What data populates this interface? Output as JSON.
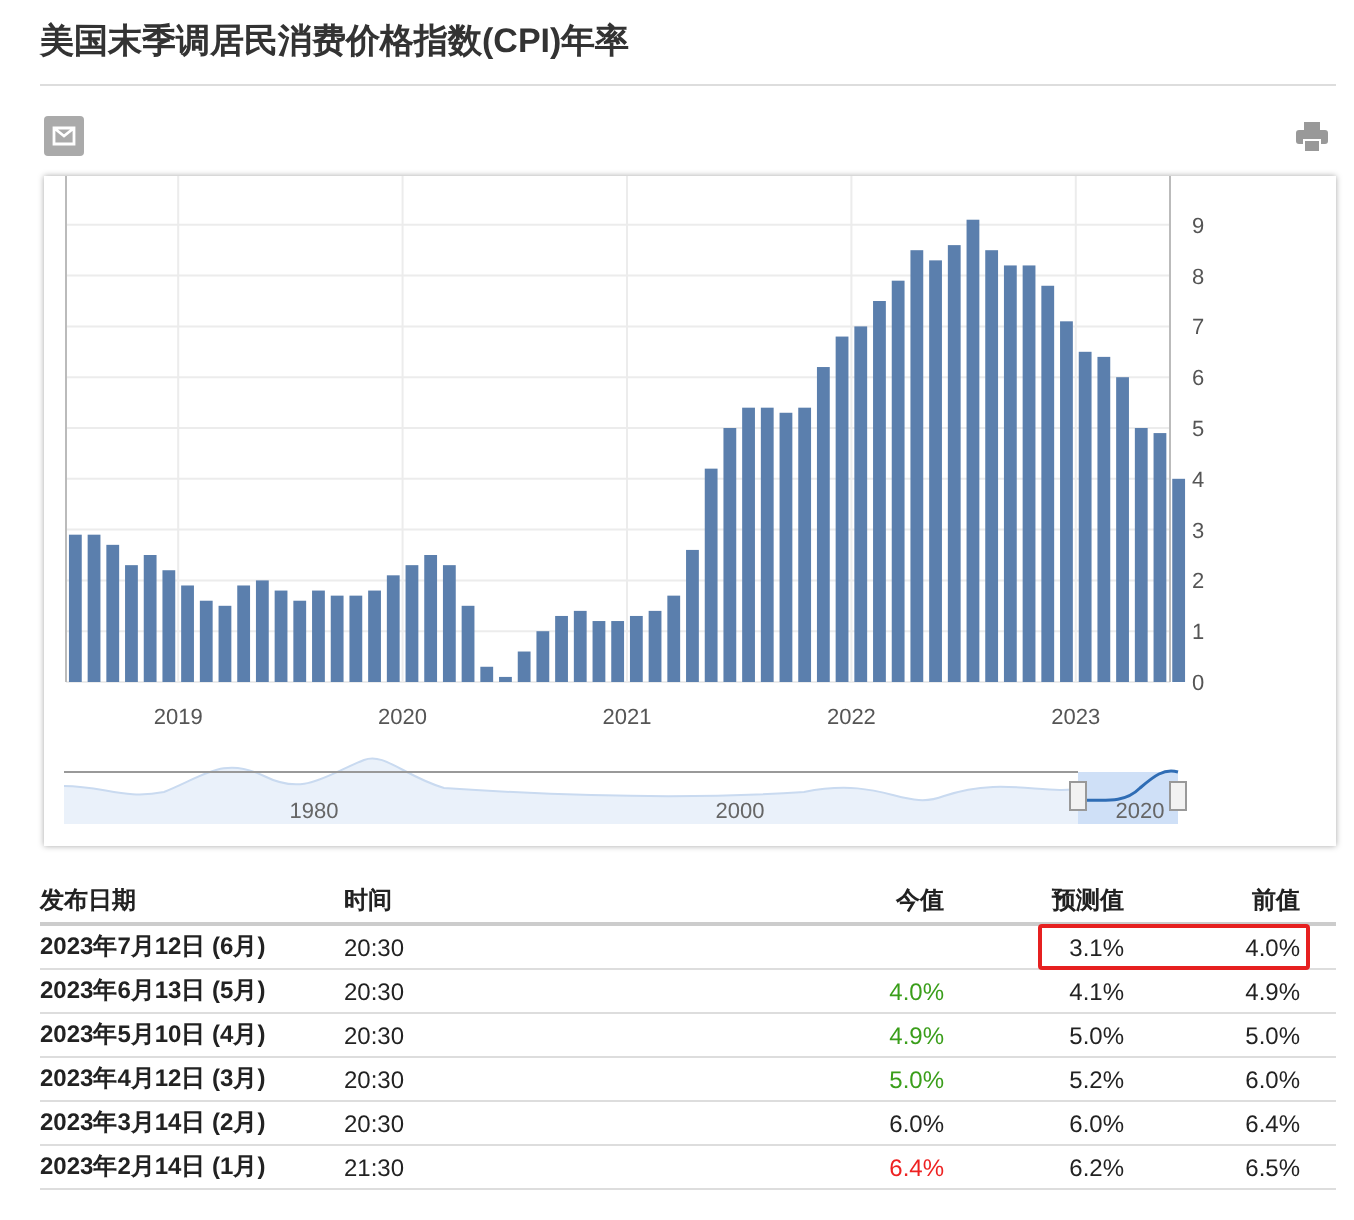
{
  "title": "美国末季调居民消费价格指数(CPI)年率",
  "chart": {
    "year_labels": [
      "2019",
      "2020",
      "2021",
      "2022",
      "2023"
    ],
    "chart_data": {
      "type": "bar",
      "grid": true,
      "ylim": [
        0,
        10
      ],
      "yticks": [
        0,
        1,
        2,
        3,
        4,
        5,
        6,
        7,
        8,
        9
      ],
      "series": [
        {
          "color": "#5b7fad",
          "values": [
            2.9,
            2.9,
            2.7,
            2.3,
            2.5,
            2.2,
            1.9,
            1.6,
            1.5,
            1.9,
            2.0,
            1.8,
            1.6,
            1.8,
            1.7,
            1.7,
            1.8,
            2.1,
            2.3,
            2.5,
            2.3,
            1.5,
            0.3,
            0.1,
            0.6,
            1.0,
            1.3,
            1.4,
            1.2,
            1.2,
            1.3,
            1.4,
            1.7,
            2.6,
            4.2,
            5.0,
            5.4,
            5.4,
            5.3,
            5.4,
            6.2,
            6.8,
            7.0,
            7.5,
            7.9,
            8.5,
            8.3,
            8.6,
            9.1,
            8.5,
            8.2,
            8.2,
            7.8,
            7.1,
            6.5,
            6.4,
            6.0,
            5.0,
            4.9,
            4.0
          ]
        }
      ]
    },
    "navigator_labels": [
      "1980",
      "2000",
      "2020"
    ]
  },
  "table": {
    "columns": [
      "发布日期",
      "时间",
      "今值",
      "预测值",
      "前值"
    ],
    "rows": [
      {
        "date": "2023年7月12日 (6月)",
        "time": "20:30",
        "forecast": "3.1%",
        "previous": "4.0%",
        "highlighted": true
      },
      {
        "date": "2023年6月13日 (5月)",
        "time": "20:30",
        "actual": "4.0%",
        "color": "#3a9e1a",
        "forecast": "4.1%",
        "previous": "4.9%",
        "highlighted": false
      },
      {
        "date": "2023年5月10日 (4月)",
        "time": "20:30",
        "actual": "4.9%",
        "color": "#3a9e1a",
        "forecast": "5.0%",
        "previous": "5.0%",
        "highlighted": false
      },
      {
        "date": "2023年4月12日 (3月)",
        "time": "20:30",
        "actual": "5.0%",
        "color": "#3a9e1a",
        "forecast": "5.2%",
        "previous": "6.0%",
        "highlighted": false
      },
      {
        "date": "2023年3月14日 (2月)",
        "time": "20:30",
        "actual": "6.0%",
        "color": "#222222",
        "forecast": "6.0%",
        "previous": "6.4%",
        "highlighted": false
      },
      {
        "date": "2023年2月14日 (1月)",
        "time": "21:30",
        "actual": "6.4%",
        "color": "#ee2222",
        "forecast": "6.2%",
        "previous": "6.5%",
        "highlighted": false
      }
    ]
  }
}
